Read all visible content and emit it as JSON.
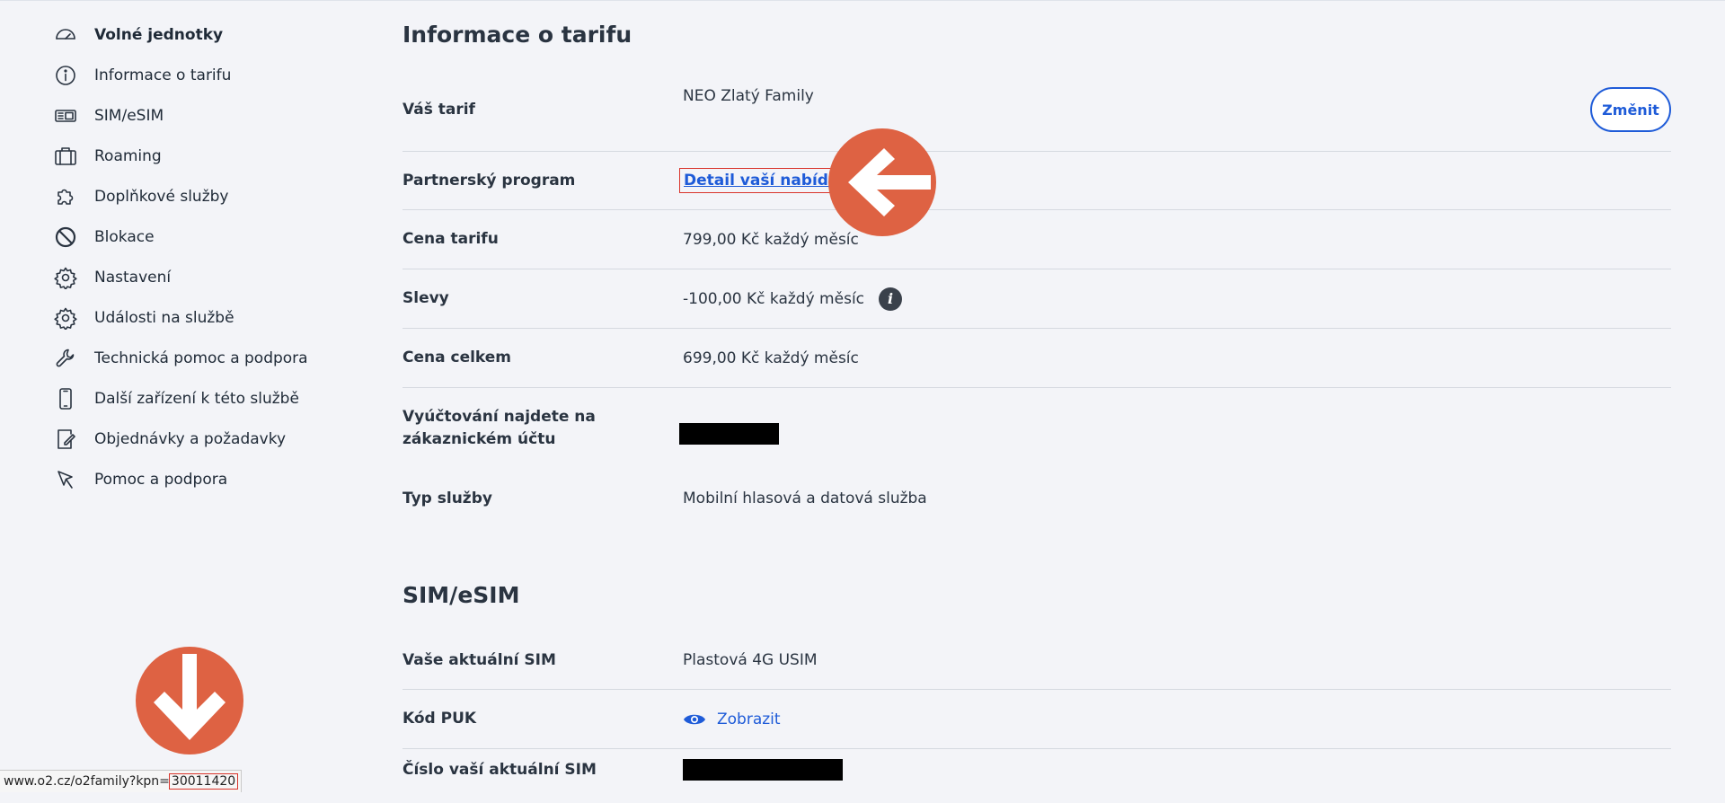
{
  "sidebar": {
    "items": [
      {
        "label": "Volné jednotky",
        "icon": "speedometer-icon"
      },
      {
        "label": "Informace o tarifu",
        "icon": "info-circle-icon"
      },
      {
        "label": "SIM/eSIM",
        "icon": "sim-card-icon"
      },
      {
        "label": "Roaming",
        "icon": "suitcase-icon"
      },
      {
        "label": "Doplňkové služby",
        "icon": "puzzle-icon"
      },
      {
        "label": "Blokace",
        "icon": "block-icon"
      },
      {
        "label": "Nastavení",
        "icon": "gear-icon"
      },
      {
        "label": "Události na službě",
        "icon": "gear-icon"
      },
      {
        "label": "Technická pomoc a podpora",
        "icon": "wrench-icon"
      },
      {
        "label": "Další zařízení k této službě",
        "icon": "phone-icon"
      },
      {
        "label": "Objednávky a požadavky",
        "icon": "document-edit-icon"
      },
      {
        "label": "Pomoc a podpora",
        "icon": "cursor-icon"
      }
    ]
  },
  "tariff": {
    "title": "Informace o tarifu",
    "rows": {
      "tarif": {
        "label": "Váš tarif",
        "value": "NEO Zlatý Family",
        "button": "Změnit"
      },
      "partner": {
        "label": "Partnerský program",
        "link": "Detail vaší nabídky"
      },
      "cena": {
        "label": "Cena tarifu",
        "value": "799,00 Kč každý měsíc"
      },
      "slevy": {
        "label": "Slevy",
        "value": "-100,00 Kč každý měsíc",
        "info_symbol": "i"
      },
      "celkem": {
        "label": "Cena celkem",
        "value": "699,00 Kč každý měsíc"
      },
      "vyuctovani": {
        "label": "Vyúčtování najdete na zákaznickém účtu"
      },
      "typ": {
        "label": "Typ služby",
        "value": "Mobilní hlasová a datová služba"
      }
    }
  },
  "sim": {
    "title": "SIM/eSIM",
    "rows": {
      "aktualni": {
        "label": "Vaše aktuální SIM",
        "value": "Plastová 4G USIM"
      },
      "puk": {
        "label": "Kód PUK",
        "link": "Zobrazit"
      },
      "cislo": {
        "label": "Číslo vaší aktuální SIM"
      }
    }
  },
  "statusbar": {
    "url_prefix": "www.o2.cz/o2family?kpn=",
    "kpn": "30011420"
  },
  "colors": {
    "accent": "#1e5bd8",
    "annotation": "#de6243",
    "highlight_box": "#d9342b"
  }
}
